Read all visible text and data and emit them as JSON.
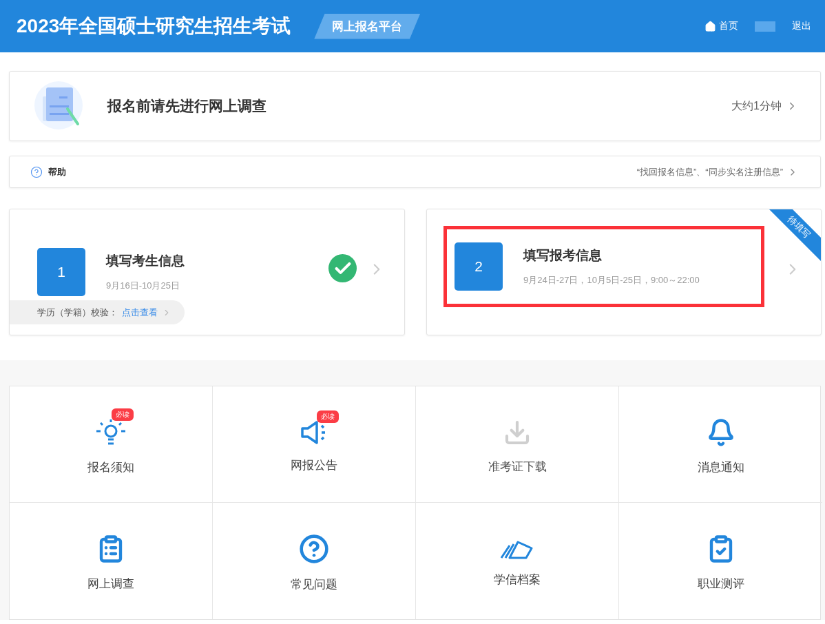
{
  "header": {
    "title": "2023年全国硕士研究生招生考试",
    "platform": "网上报名平台",
    "nav": [
      {
        "label": "首页",
        "kind": "home"
      },
      {
        "kind": "user"
      },
      {
        "label": "退出",
        "kind": "link"
      }
    ]
  },
  "survey": {
    "title": "报名前请先进行网上调查",
    "duration": "大约1分钟"
  },
  "help": {
    "label": "帮助",
    "links": "“找回报名信息”、“同步实名注册信息”"
  },
  "steps": [
    {
      "number": "1",
      "title": "填写考生信息",
      "dates": "9月16日-10月25日",
      "completed": true,
      "highlighted": false,
      "verify": {
        "label": "学历（学籍）校验：",
        "link": "点击查看"
      }
    },
    {
      "number": "2",
      "title": "填写报考信息",
      "dates": "9月24日-27日，10月5日-25日，9:00～22:00",
      "completed": false,
      "highlighted": true,
      "ribbon": "待填写"
    }
  ],
  "grid": [
    {
      "label": "报名须知",
      "badge": "必读",
      "disabled": false
    },
    {
      "label": "网报公告",
      "badge": "必读",
      "disabled": false
    },
    {
      "label": "准考证下载",
      "disabled": true
    },
    {
      "label": "消息通知",
      "disabled": false
    },
    {
      "label": "网上调查",
      "disabled": false
    },
    {
      "label": "常见问题",
      "disabled": false
    },
    {
      "label": "学信档案",
      "disabled": false
    },
    {
      "label": "职业测评",
      "disabled": false
    }
  ]
}
